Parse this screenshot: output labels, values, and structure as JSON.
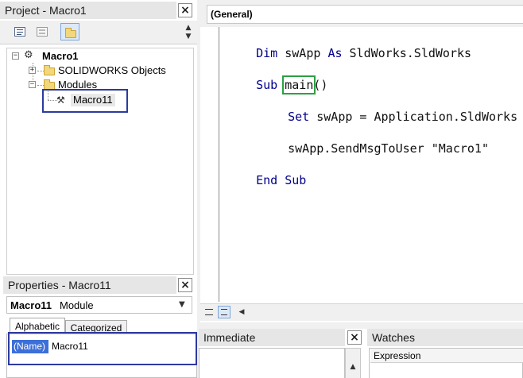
{
  "project_pane": {
    "title": "Project - Macro1",
    "close_glyph": "×",
    "toolbar": {
      "view_code_icon": "view-code-icon",
      "view_object_icon": "view-object-icon",
      "toggle_folders_icon": "toggle-folders-icon"
    },
    "tree": {
      "root_label": "Macro1",
      "solidworks_objects_label": "SOLIDWORKS Objects",
      "modules_label": "Modules",
      "module_item_label": "Macro11",
      "expand_glyph": "+",
      "collapse_glyph": "−"
    }
  },
  "properties_pane": {
    "title": "Properties - Macro11",
    "close_glyph": "×",
    "object_selector": {
      "name": "Macro11",
      "type": "Module"
    },
    "tabs": [
      {
        "label": "Alphabetic"
      },
      {
        "label": "Categorized"
      }
    ],
    "rows": [
      {
        "name": "(Name)",
        "value": "Macro11"
      }
    ]
  },
  "code_pane": {
    "object_dropdown": "(General)",
    "lines": [
      {
        "kw1": "Dim",
        "text1": " swApp ",
        "kw2": "As",
        "text2": " SldWorks.SldWorks"
      },
      {
        "kw1": "Sub",
        "text1": " ",
        "highlight": "main",
        "text2": "()"
      },
      {
        "kw1": "Set",
        "text1": " swApp = Application.SldWorks"
      },
      {
        "text1": "swApp.SendMsgToUser ",
        "str": "\"Macro1\""
      },
      {
        "kw1": "End",
        "text1": " ",
        "kw2": "Sub"
      }
    ]
  },
  "immediate_pane": {
    "title": "Immediate",
    "close_glyph": "×"
  },
  "watches_pane": {
    "title": "Watches",
    "column_header": "Expression"
  },
  "colors": {
    "keyword": "#00008b",
    "highlight_green": "#2ea043",
    "highlight_blue": "#2c3aa0",
    "selection_blue": "#3c6fd8"
  }
}
